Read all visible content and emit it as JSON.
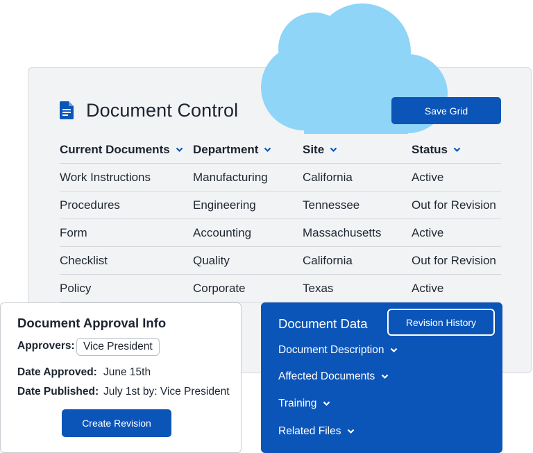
{
  "main": {
    "title": "Document Control",
    "save_label": "Save Grid",
    "columns": [
      "Current Documents",
      "Department",
      "Site",
      "Status"
    ],
    "rows": [
      [
        "Work Instructions",
        "Manufacturing",
        "California",
        "Active"
      ],
      [
        "Procedures",
        "Engineering",
        "Tennessee",
        "Out for Revision"
      ],
      [
        "Form",
        "Accounting",
        "Massachusetts",
        "Active"
      ],
      [
        "Checklist",
        "Quality",
        "California",
        "Out for Revision"
      ],
      [
        "Policy",
        "Corporate",
        "Texas",
        "Active"
      ]
    ]
  },
  "approval": {
    "title": "Document Approval Info",
    "approvers_label": "Approvers:",
    "approvers_value": "Vice President",
    "date_approved_label": "Date Approved:",
    "date_approved_value": "June 15th",
    "date_published_label": "Date Published:",
    "date_published_value": "July 1st by: Vice President",
    "create_label": "Create Revision"
  },
  "data_panel": {
    "title": "Document Data",
    "revision_history_label": "Revision History",
    "items": [
      "Document Description",
      "Affected Documents",
      "Training",
      "Related Files"
    ]
  },
  "colors": {
    "brand_blue": "#0c55b8",
    "cloud": "#8fd5f7",
    "card_bg": "#f2f3f5"
  },
  "icons": {
    "title_icon": "document-icon",
    "header_sort": "chevron-down-icon",
    "decor": "cloud-icon"
  }
}
